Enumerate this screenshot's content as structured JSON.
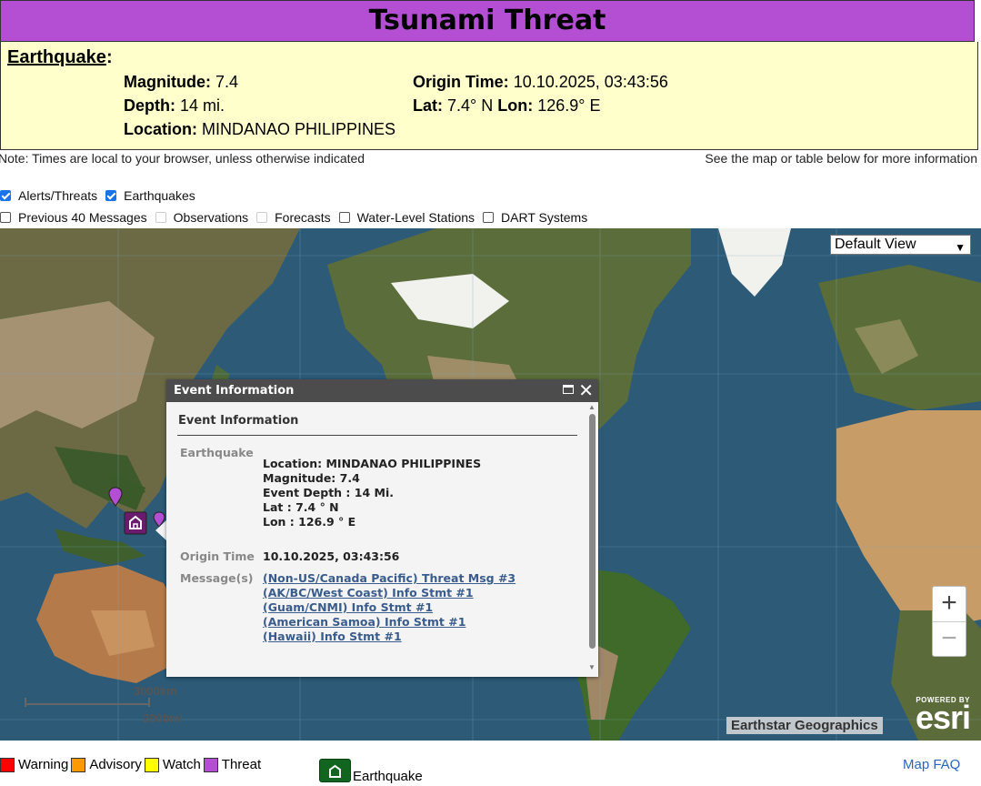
{
  "header": {
    "title": "Tsunami Threat"
  },
  "earthquake": {
    "heading": "Earthquake",
    "magnitude_label": "Magnitude:",
    "magnitude": "7.4",
    "depth_label": "Depth:",
    "depth": "14 mi.",
    "location_label": "Location:",
    "location": "MINDANAO PHILIPPINES",
    "origin_label": "Origin Time:",
    "origin": "10.10.2025, 03:43:56",
    "lat_label": "Lat:",
    "lat": "7.4° N",
    "lon_label": "Lon:",
    "lon": "126.9° E"
  },
  "notes": {
    "left": "Note: Times are local to your browser, unless otherwise indicated",
    "right": "See the map or table below for more information"
  },
  "layers": {
    "row1": [
      {
        "label": "Alerts/Threats",
        "checked": true
      },
      {
        "label": "Earthquakes",
        "checked": true
      }
    ],
    "row2": [
      {
        "label": "Previous 40 Messages",
        "checked": false
      },
      {
        "label": "Observations",
        "checked": false,
        "disabled": true
      },
      {
        "label": "Forecasts",
        "checked": false,
        "disabled": true
      },
      {
        "label": "Water-Level Stations",
        "checked": false
      },
      {
        "label": "DART Systems",
        "checked": false
      }
    ]
  },
  "map": {
    "view_select": "Default View",
    "zoom_in": "+",
    "zoom_out": "−",
    "scale_km": "3000km",
    "scale_mi": "2000mi",
    "attribution": "Earthstar Geographics",
    "esri_small": "POWERED BY",
    "esri_big": "esri"
  },
  "popup": {
    "header": "Event Information",
    "title": "Event Information",
    "eq_label": "Earthquake",
    "eq_lines": [
      "Location: MINDANAO PHILIPPINES",
      "Magnitude: 7.4",
      "Event Depth : 14 Mi.",
      "Lat : 7.4 ° N",
      "Lon : 126.9 ° E"
    ],
    "origin_label": "Origin Time",
    "origin_value": "10.10.2025, 03:43:56",
    "messages_label": "Message(s)",
    "messages": [
      "(Non-US/Canada Pacific) Threat Msg #3",
      "(AK/BC/West Coast) Info Stmt #1",
      "(Guam/CNMI) Info Stmt #1",
      "(American Samoa) Info Stmt #1",
      "(Hawaii) Info Stmt #1"
    ]
  },
  "legend": {
    "items": [
      {
        "label": "Warning",
        "color": "#ff0000"
      },
      {
        "label": "Advisory",
        "color": "#ff9900"
      },
      {
        "label": "Watch",
        "color": "#ffff00"
      },
      {
        "label": "Threat",
        "color": "#b44fd3"
      }
    ],
    "earthquake": "Earthquake",
    "faq": "Map FAQ"
  }
}
